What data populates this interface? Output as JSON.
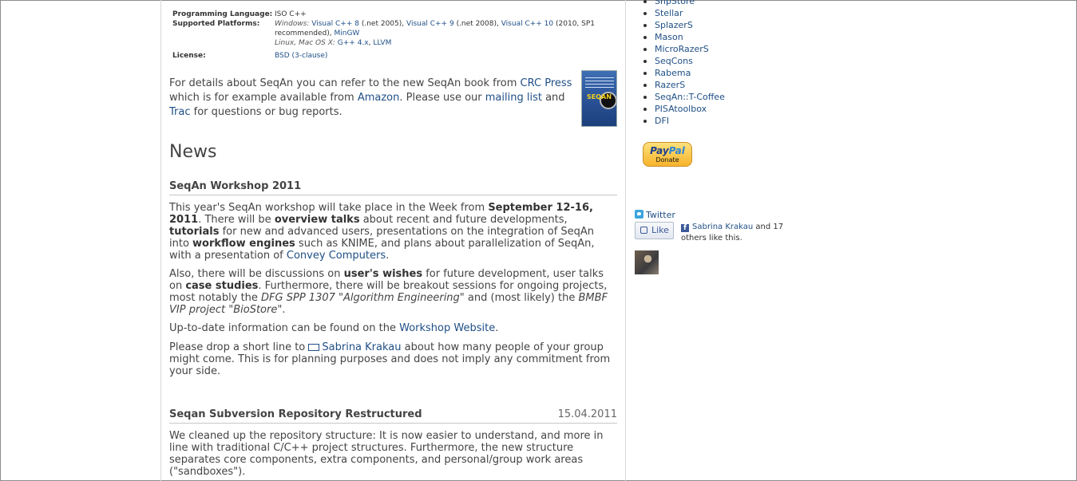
{
  "info": {
    "programming_language": {
      "label": "Programming Language:",
      "value": "ISO C++"
    },
    "supported_platforms": {
      "label": "Supported Platforms:",
      "windows_prefix": "Windows:",
      "vc8": "Visual C++ 8",
      "vc8_note": "(.net 2005),",
      "vc9": "Visual C++ 9",
      "vc9_note": "(.net 2008),",
      "vc10": "Visual C++ 10",
      "vc10_note": "(2010, SP1 recommended),",
      "mingw": "MinGW",
      "linux_prefix": "Linux, Mac OS X:",
      "gpp": "G++ 4.x",
      "sep": ",",
      "llvm": "LLVM"
    },
    "license": {
      "label": "License:",
      "value": "BSD (3-clause)"
    }
  },
  "intro": {
    "t1": "For details about SeqAn you can refer to the new SeqAn book from ",
    "crc": "CRC Press",
    "t2": " which is for example available from ",
    "amazon": "Amazon",
    "t3": ". Please use our ",
    "mailing": "mailing list",
    "t4": " and ",
    "trac": "Trac",
    "t5": " for questions or bug reports.",
    "cover_text": "SEQAN"
  },
  "news_heading": "News",
  "workshop": {
    "title": "SeqAn Workshop 2011",
    "p1": {
      "a": "This year's SeqAn workshop will take place in the Week from ",
      "b": "September 12-16, 2011",
      "c": ". There will be ",
      "d": "overview talks",
      "e": " about recent and future developments, ",
      "f": "tutorials",
      "g": " for new and advanced users, presentations on the integration of SeqAn into ",
      "h": "workflow engines",
      "i": " such as KNIME, and plans about parallelization of SeqAn, with a presentation of ",
      "link": "Convey Computers",
      "j": "."
    },
    "p2": {
      "a": "Also, there will be discussions on ",
      "b": "user's wishes",
      "c": " for future development, user talks on ",
      "d": "case studies",
      "e": ". Furthermore, there will be breakout sessions for ongoing projects, most notably the ",
      "f": "DFG SPP 1307 \"Algorithm Engineering\"",
      "g": " and (most likely) the ",
      "h": "BMBF VIP project \"BioStore\"",
      "i": "."
    },
    "p3": {
      "a": "Up-to-date information can be found on the ",
      "link": "Workshop Website",
      "b": "."
    },
    "p4": {
      "a": "Please drop a short line to ",
      "link": "Sabrina Krakau",
      "b": " about how many people of your group might come. This is for planning purposes and does not imply any commitment from your side."
    }
  },
  "svn": {
    "title": "Seqan Subversion Repository Restructured",
    "date": "15.04.2011",
    "p1": "We cleaned up the repository structure: It is now easier to understand, and more in line with traditional C/C++ project structures. Furthermore, the new structure separates core components, extra components, and personal/group work areas (\"sandboxes\")."
  },
  "sidebar": {
    "items": [
      "ShpStore",
      "Stellar",
      "SplazerS",
      "Mason",
      "MicroRazerS",
      "SeqCons",
      "Rabema",
      "RazerS",
      "SeqAn::T-Coffee",
      "PISAtoolbox",
      "DFI"
    ],
    "paypal_logo_a": "Pay",
    "paypal_logo_b": "Pal",
    "paypal_donate": "Donate",
    "twitter": "Twitter",
    "like": "Like",
    "fb_name": "Sabrina Krakau",
    "fb_rest": " and 17 others like this."
  }
}
